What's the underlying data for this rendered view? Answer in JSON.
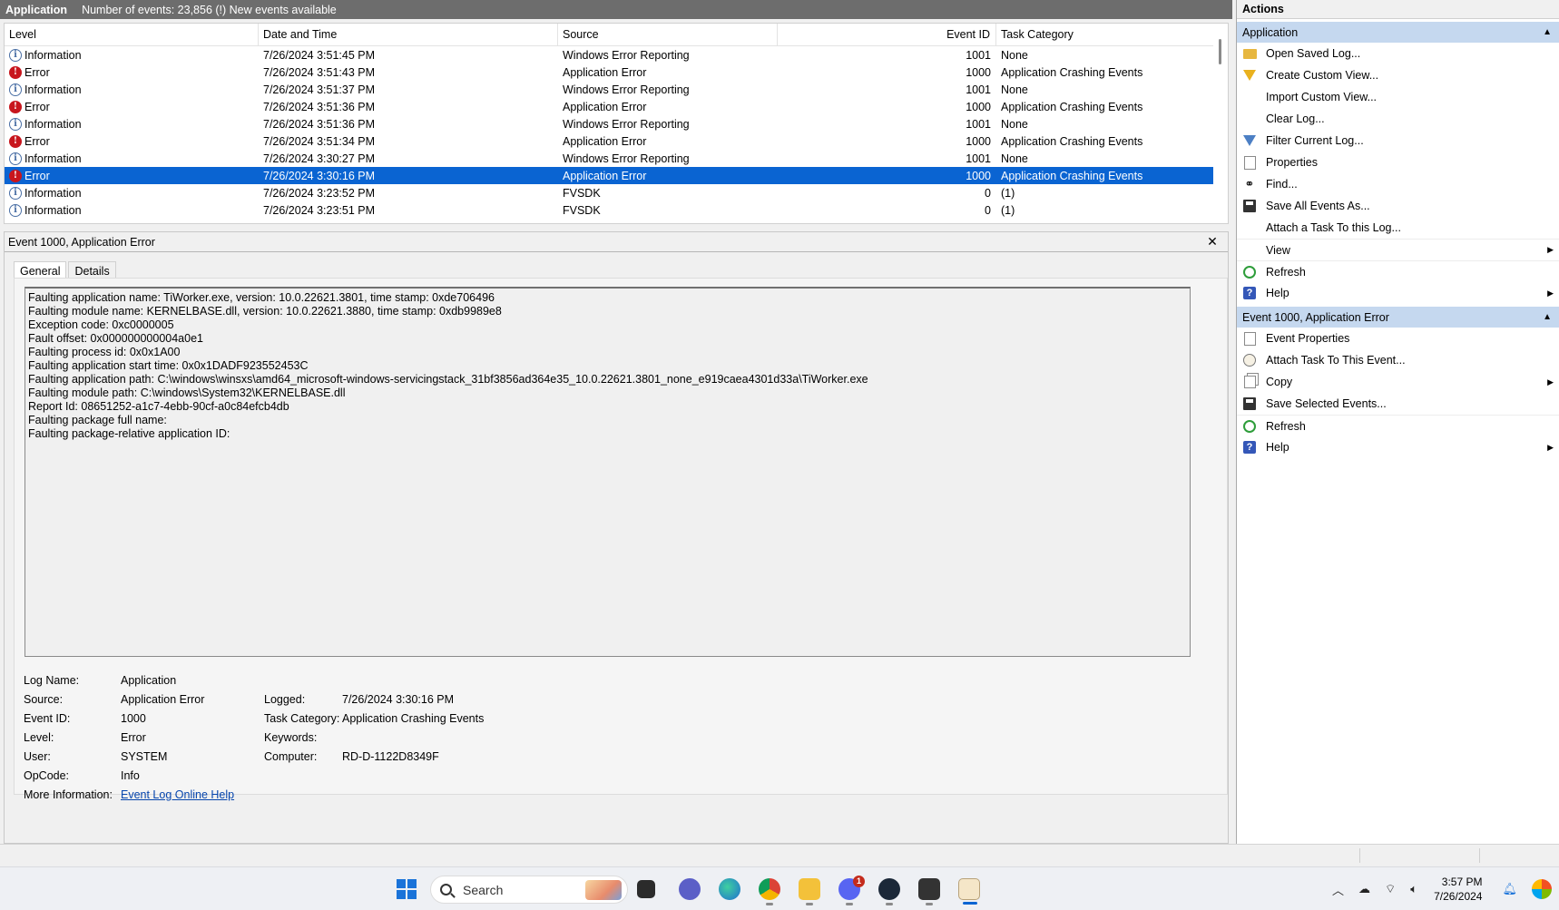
{
  "log_header": {
    "title": "Application",
    "count_text": "Number of events: 23,856 (!) New events available"
  },
  "event_list": {
    "columns": [
      "Level",
      "Date and Time",
      "Source",
      "Event ID",
      "Task Category"
    ],
    "rows": [
      {
        "level": "Information",
        "datetime": "7/26/2024 3:51:45 PM",
        "source": "Windows Error Reporting",
        "event_id": "1001",
        "category": "None"
      },
      {
        "level": "Error",
        "datetime": "7/26/2024 3:51:43 PM",
        "source": "Application Error",
        "event_id": "1000",
        "category": "Application Crashing Events"
      },
      {
        "level": "Information",
        "datetime": "7/26/2024 3:51:37 PM",
        "source": "Windows Error Reporting",
        "event_id": "1001",
        "category": "None"
      },
      {
        "level": "Error",
        "datetime": "7/26/2024 3:51:36 PM",
        "source": "Application Error",
        "event_id": "1000",
        "category": "Application Crashing Events"
      },
      {
        "level": "Information",
        "datetime": "7/26/2024 3:51:36 PM",
        "source": "Windows Error Reporting",
        "event_id": "1001",
        "category": "None"
      },
      {
        "level": "Error",
        "datetime": "7/26/2024 3:51:34 PM",
        "source": "Application Error",
        "event_id": "1000",
        "category": "Application Crashing Events"
      },
      {
        "level": "Information",
        "datetime": "7/26/2024 3:30:27 PM",
        "source": "Windows Error Reporting",
        "event_id": "1001",
        "category": "None"
      },
      {
        "level": "Error",
        "datetime": "7/26/2024 3:30:16 PM",
        "source": "Application Error",
        "event_id": "1000",
        "category": "Application Crashing Events"
      },
      {
        "level": "Information",
        "datetime": "7/26/2024 3:23:52 PM",
        "source": "FVSDK",
        "event_id": "0",
        "category": "(1)"
      },
      {
        "level": "Information",
        "datetime": "7/26/2024 3:23:51 PM",
        "source": "FVSDK",
        "event_id": "0",
        "category": "(1)"
      }
    ],
    "selected_index": 7
  },
  "detail": {
    "title": "Event 1000, Application Error",
    "tabs": [
      "General",
      "Details"
    ],
    "description_lines": [
      "Faulting application name: TiWorker.exe, version: 10.0.22621.3801, time stamp: 0xde706496",
      "Faulting module name: KERNELBASE.dll, version: 10.0.22621.3880, time stamp: 0xdb9989e8",
      "Exception code: 0xc0000005",
      "Fault offset: 0x000000000004a0e1",
      "Faulting process id: 0x0x1A00",
      "Faulting application start time: 0x0x1DADF923552453C",
      "Faulting application path: C:\\windows\\winsxs\\amd64_microsoft-windows-servicingstack_31bf3856ad364e35_10.0.22621.3801_none_e919caea4301d33a\\TiWorker.exe",
      "Faulting module path: C:\\windows\\System32\\KERNELBASE.dll",
      "Report Id: 08651252-a1c7-4ebb-90cf-a0c84efcb4db",
      "Faulting package full name:",
      "Faulting package-relative application ID:"
    ],
    "props": {
      "log_name_label": "Log Name:",
      "log_name": "Application",
      "source_label": "Source:",
      "source": "Application Error",
      "logged_label": "Logged:",
      "logged": "7/26/2024 3:30:16 PM",
      "event_id_label": "Event ID:",
      "event_id": "1000",
      "task_category_label": "Task Category:",
      "task_category": "Application Crashing Events",
      "level_label": "Level:",
      "level": "Error",
      "keywords_label": "Keywords:",
      "keywords": "",
      "user_label": "User:",
      "user": "SYSTEM",
      "computer_label": "Computer:",
      "computer": "RD-D-1122D8349F",
      "opcode_label": "OpCode:",
      "opcode": "Info",
      "more_info_label": "More Information:",
      "more_info_link": "Event Log Online Help"
    }
  },
  "actions": {
    "title": "Actions",
    "section1": {
      "title": "Application",
      "items": [
        {
          "label": "Open Saved Log...",
          "icon": "open-folder-icon"
        },
        {
          "label": "Create Custom View...",
          "icon": "filter-icon"
        },
        {
          "label": "Import Custom View...",
          "icon": ""
        },
        {
          "label": "Clear Log...",
          "icon": ""
        },
        {
          "label": "Filter Current Log...",
          "icon": "filter-icon"
        },
        {
          "label": "Properties",
          "icon": "properties-icon"
        },
        {
          "label": "Find...",
          "icon": "binoculars-icon"
        },
        {
          "label": "Save All Events As...",
          "icon": "save-icon"
        },
        {
          "label": "Attach a Task To this Log...",
          "icon": ""
        },
        {
          "label": "View",
          "icon": ""
        },
        {
          "label": "Refresh",
          "icon": "refresh-icon"
        },
        {
          "label": "Help",
          "icon": "help-icon"
        }
      ]
    },
    "section2": {
      "title": "Event 1000, Application Error",
      "items": [
        {
          "label": "Event Properties",
          "icon": "properties-icon"
        },
        {
          "label": "Attach Task To This Event...",
          "icon": "task-icon"
        },
        {
          "label": "Copy",
          "icon": "copy-icon"
        },
        {
          "label": "Save Selected Events...",
          "icon": "save-icon"
        },
        {
          "label": "Refresh",
          "icon": "refresh-icon"
        },
        {
          "label": "Help",
          "icon": "help-icon"
        }
      ]
    }
  },
  "taskbar": {
    "search_placeholder": "Search",
    "chat_badge": "1",
    "clock_time": "3:57 PM",
    "clock_date": "7/26/2024"
  },
  "colors": {
    "selection": "#0a64d2",
    "section_header": "#c5d8ef",
    "error_icon": "#c8161d",
    "header_bar": "#6d6d6d"
  }
}
